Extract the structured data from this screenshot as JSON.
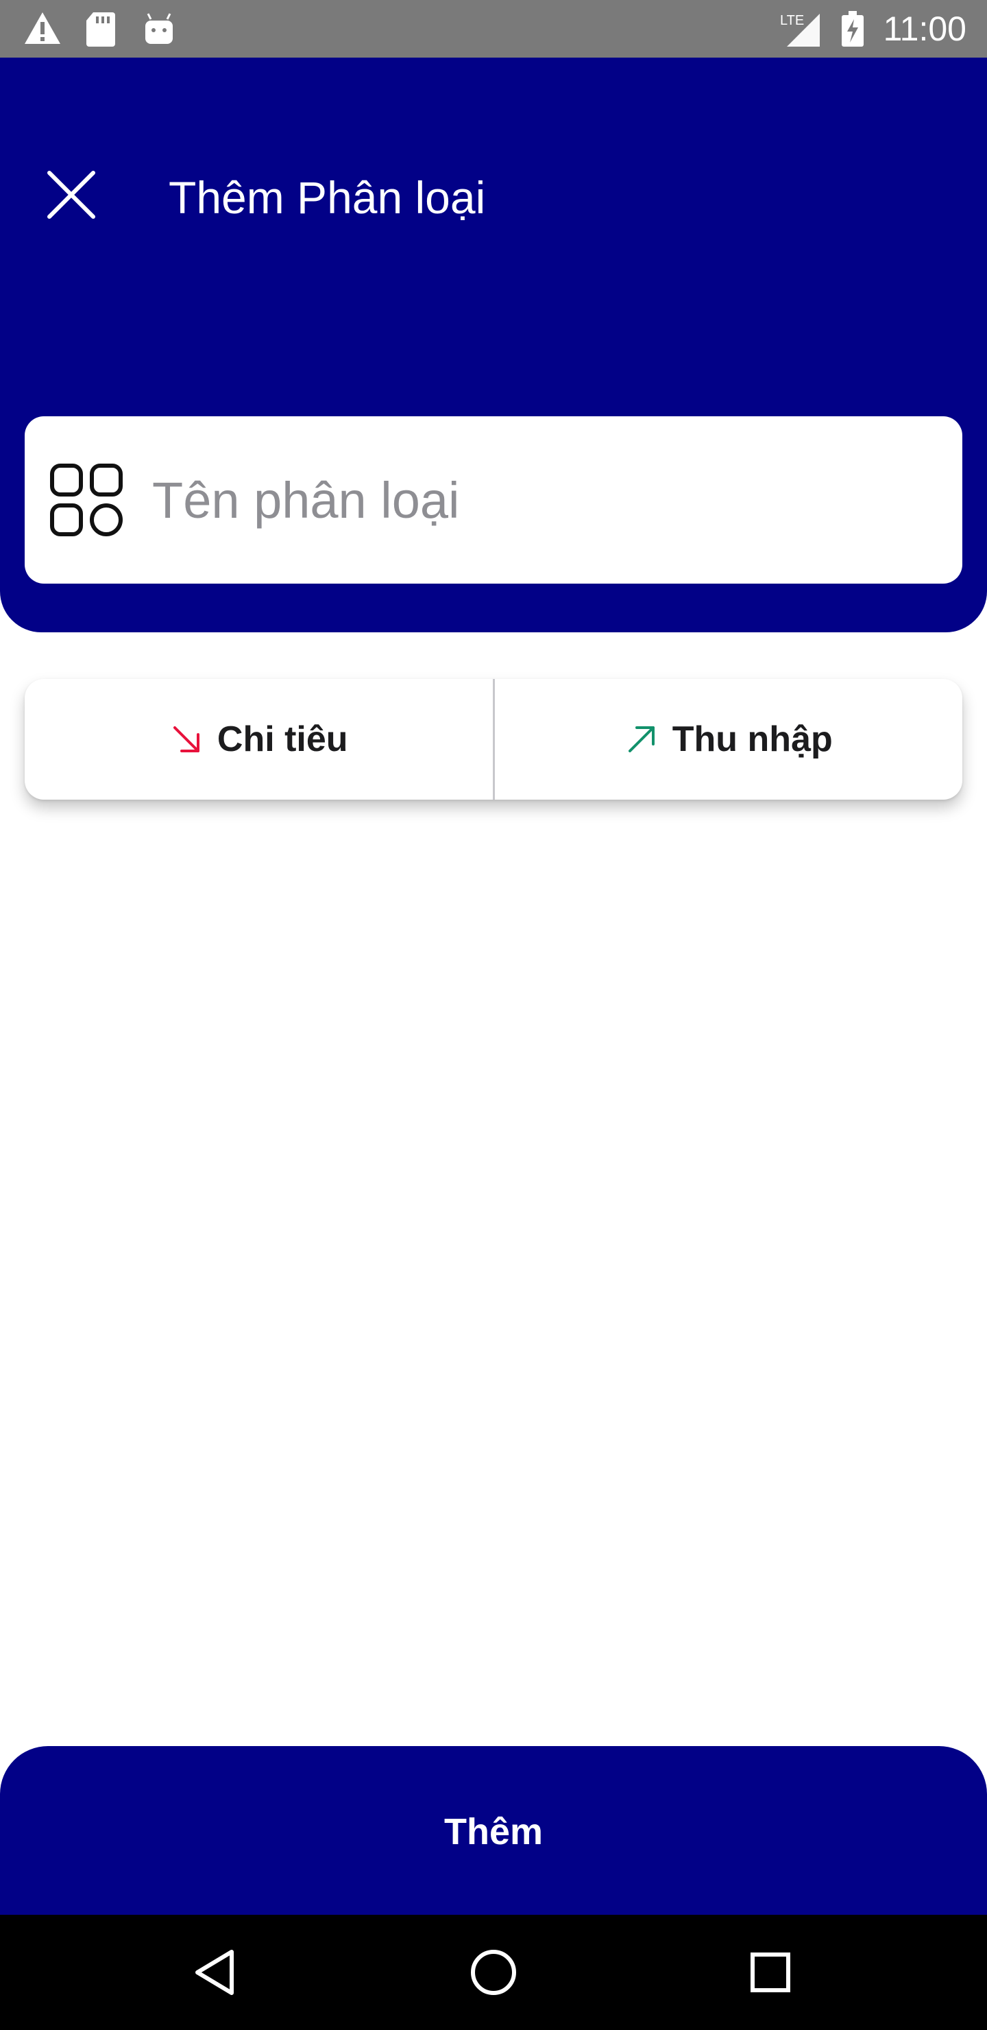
{
  "status_bar": {
    "time": "11:00",
    "icons": [
      "warning-icon",
      "sd-card-icon",
      "android-icon",
      "lte-signal-icon",
      "battery-charging-icon"
    ],
    "network_label": "LTE"
  },
  "header": {
    "title": "Thêm Phân loại",
    "close_icon": "close-icon"
  },
  "name_field": {
    "icon": "category-grid-icon",
    "placeholder": "Tên phân loại",
    "value": ""
  },
  "type_toggle": {
    "options": [
      {
        "label": "Chi tiêu",
        "icon": "arrow-down-right-icon",
        "color": "#e8123c"
      },
      {
        "label": "Thu nhập",
        "icon": "arrow-up-right-icon",
        "color": "#12916b"
      }
    ]
  },
  "submit": {
    "label": "Thêm"
  },
  "nav_bar": {
    "icons": [
      "back-icon",
      "home-icon",
      "recents-icon"
    ]
  },
  "colors": {
    "primary": "#020187",
    "status_bar": "#7a7a7a",
    "placeholder": "#8e8e93",
    "expense": "#e8123c",
    "income": "#12916b"
  }
}
